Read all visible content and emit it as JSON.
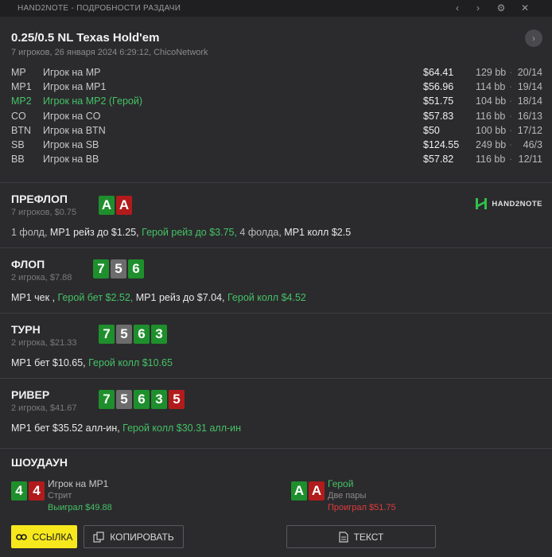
{
  "window": {
    "title": "HAND2NOTE - ПОДРОБНОСТИ РАЗДАЧИ",
    "prev_icon": "‹",
    "next_icon": "›",
    "settings_icon": "⚙",
    "close_icon": "✕"
  },
  "header": {
    "title": "0.25/0.5 NL Texas Hold'em",
    "subtitle": "7 игроков, 26 января 2024 6:29:12, ChicoNetwork",
    "next_button": "›"
  },
  "players": [
    {
      "pos": "MP",
      "name": "Игрок на MP",
      "stack": "$64.41",
      "bb": "129 bb",
      "dot": "·",
      "record": "20/14",
      "hero": false
    },
    {
      "pos": "MP1",
      "name": "Игрок на MP1",
      "stack": "$56.96",
      "bb": "114 bb",
      "dot": "·",
      "record": "19/14",
      "hero": false
    },
    {
      "pos": "MP2",
      "name": "Игрок на MP2 (Герой)",
      "stack": "$51.75",
      "bb": "104 bb",
      "dot": "·",
      "record": "18/14",
      "hero": true
    },
    {
      "pos": "CO",
      "name": "Игрок на CO",
      "stack": "$57.83",
      "bb": "116 bb",
      "dot": "·",
      "record": "16/13",
      "hero": false
    },
    {
      "pos": "BTN",
      "name": "Игрок на BTN",
      "stack": "$50",
      "bb": "100 bb",
      "dot": "·",
      "record": "17/12",
      "hero": false
    },
    {
      "pos": "SB",
      "name": "Игрок на SB",
      "stack": "$124.55",
      "bb": "249 bb",
      "dot": "·",
      "record": "46/3",
      "hero": false
    },
    {
      "pos": "BB",
      "name": "Игрок на BB",
      "stack": "$57.82",
      "bb": "116 bb",
      "dot": "·",
      "record": "12/11",
      "hero": false
    }
  ],
  "logo": {
    "text": "HAND2NOTE"
  },
  "preflop": {
    "title": "ПРЕФЛОП",
    "subtitle": "7 игроков, $0.75",
    "cards": [
      {
        "rank": "A",
        "color": "#1e8f2c"
      },
      {
        "rank": "A",
        "color": "#b21b1b"
      }
    ],
    "action": [
      {
        "text": "1 фолд, ",
        "style": "muted"
      },
      {
        "text": "MP1 рейз до $1.25, ",
        "style": "plain"
      },
      {
        "text": "Герой рейз до $3.75, ",
        "style": "hero"
      },
      {
        "text": "4 фолда, ",
        "style": "muted"
      },
      {
        "text": "MP1 колл $2.5",
        "style": "plain"
      }
    ]
  },
  "flop": {
    "title": "ФЛОП",
    "subtitle": "2 игрока, $7.88",
    "cards": [
      {
        "rank": "7",
        "color": "#1e8f2c"
      },
      {
        "rank": "5",
        "color": "#6c6c6c"
      },
      {
        "rank": "6",
        "color": "#1e8f2c"
      }
    ],
    "action": [
      {
        "text": "MP1 чек , ",
        "style": "plain"
      },
      {
        "text": "Герой бет $2.52, ",
        "style": "hero"
      },
      {
        "text": "MP1 рейз до $7.04, ",
        "style": "plain"
      },
      {
        "text": "Герой колл $4.52",
        "style": "hero"
      }
    ]
  },
  "turn": {
    "title": "ТУРН",
    "subtitle": "2 игрока, $21.33",
    "cards": [
      {
        "rank": "7",
        "color": "#1e8f2c"
      },
      {
        "rank": "5",
        "color": "#6c6c6c"
      },
      {
        "rank": "6",
        "color": "#1e8f2c"
      },
      {
        "rank": "3",
        "color": "#1e8f2c"
      }
    ],
    "action": [
      {
        "text": "MP1 бет $10.65, ",
        "style": "plain"
      },
      {
        "text": "Герой колл $10.65",
        "style": "hero"
      }
    ]
  },
  "river": {
    "title": "РИВЕР",
    "subtitle": "2 игрока, $41.67",
    "cards": [
      {
        "rank": "7",
        "color": "#1e8f2c"
      },
      {
        "rank": "5",
        "color": "#6c6c6c"
      },
      {
        "rank": "6",
        "color": "#1e8f2c"
      },
      {
        "rank": "3",
        "color": "#1e8f2c"
      },
      {
        "rank": "5",
        "color": "#b21b1b"
      }
    ],
    "action": [
      {
        "text": "MP1 бет $35.52 алл-ин, ",
        "style": "plain"
      },
      {
        "text": "Герой колл $30.31 алл-ин",
        "style": "hero"
      }
    ]
  },
  "showdown": {
    "title": "ШОУДАУН",
    "left": {
      "cards": [
        {
          "rank": "4",
          "color": "#1e8f2c"
        },
        {
          "rank": "4",
          "color": "#b21b1b"
        }
      ],
      "name": "Игрок на MP1",
      "hand": "Стрит",
      "result": "Выиграл $49.88"
    },
    "right": {
      "cards": [
        {
          "rank": "A",
          "color": "#1e8f2c"
        },
        {
          "rank": "A",
          "color": "#b21b1b"
        }
      ],
      "name": "Герой",
      "hand": "Две пары",
      "result": "Проиграл $51.75"
    }
  },
  "buttons": {
    "link": "ССЫЛКА",
    "copy": "КОПИРОВАТЬ",
    "text": "ТЕКСТ"
  }
}
